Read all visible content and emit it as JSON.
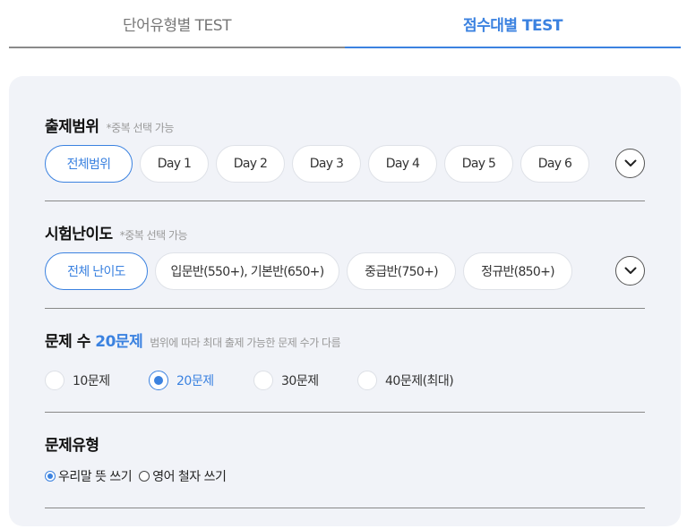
{
  "tabs": [
    {
      "label": "단어유형별 TEST",
      "active": false
    },
    {
      "label": "점수대별 TEST",
      "active": true
    }
  ],
  "range": {
    "title": "출제범위",
    "note": "*중복 선택 가능",
    "chips": [
      "전체범위",
      "Day 1",
      "Day 2",
      "Day 3",
      "Day 4",
      "Day 5",
      "Day 6"
    ],
    "selected_index": 0,
    "expand_icon": "chevron-down-icon"
  },
  "difficulty": {
    "title": "시험난이도",
    "note": "*중복 선택 가능",
    "chips": [
      "전체 난이도",
      "입문반(550+), 기본반(650+)",
      "중급반(750+)",
      "정규반(850+)"
    ],
    "selected_index": 0,
    "expand_icon": "chevron-down-icon"
  },
  "count": {
    "title_prefix": "문제 수 ",
    "title_value": "20문제",
    "note": "범위에 따라 최대 출제 가능한 문제 수가 다름",
    "options": [
      "10문제",
      "20문제",
      "30문제",
      "40문제(최대)"
    ],
    "selected_index": 1
  },
  "type": {
    "title": "문제유형",
    "options": [
      "우리말 뜻 쓰기",
      "영어 철자 쓰기"
    ],
    "selected_index": 0
  },
  "colors": {
    "accent": "#3b82e0",
    "panel_bg": "#f1f3f8",
    "divider": "#888888"
  }
}
